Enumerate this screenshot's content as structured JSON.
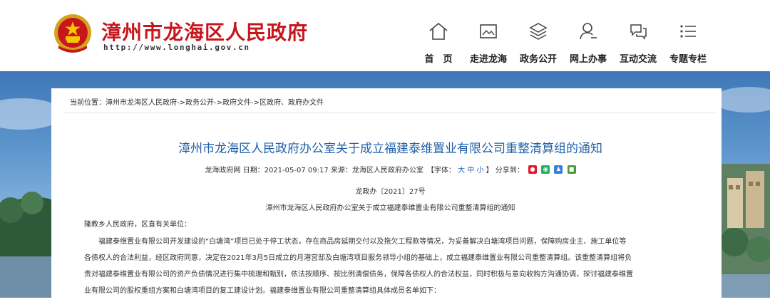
{
  "header": {
    "title": "漳州市龙海区人民政府",
    "url": "http://www.longhai.gov.cn",
    "nav": [
      {
        "label": "首　页",
        "icon": "home-icon"
      },
      {
        "label": "走进龙海",
        "icon": "picture-icon"
      },
      {
        "label": "政务公开",
        "icon": "layers-icon"
      },
      {
        "label": "网上办事",
        "icon": "user-icon"
      },
      {
        "label": "互动交流",
        "icon": "chat-icon"
      },
      {
        "label": "专题专栏",
        "icon": "list-icon"
      }
    ]
  },
  "breadcrumb": {
    "prefix": "当前位置：",
    "items": [
      "漳州市龙海区人民政府",
      "->政务公开",
      "->政府文件",
      "->区政府、政府办文件"
    ]
  },
  "article": {
    "title": "漳州市龙海区人民政府办公室关于成立福建泰维置业有限公司重整清算组的通知",
    "meta_prefix": "龙海政府网 日期：2021-05-07 09:17  来源：龙海区人民政府办公室　【字体：",
    "font_large": "大",
    "font_medium": "中",
    "font_small": "小",
    "meta_suffix": "】 分享到：",
    "doc_number": "龙政办〔2021〕27号",
    "doc_subtitle": "漳州市龙海区人民政府办公室关于成立福建泰维置业有限公司重整清算组的通知",
    "paragraphs": [
      "隆教乡人民政府，区直有关单位：",
      "　　福建泰维置业有限公司开发建设的“白塘湾”项目已处于停工状态，存在商品房延期交付以及拖欠工程款等情况，为妥善解决白塘湾项目问题，保障购房业主、施工单位等",
      "各债权人的合法利益，经区政府同意，决定在2021年3月5日成立的月港宫邸及白塘湾项目服务领导小组的基础上，成立福建泰维置业有限公司重整清算组。该重整清算组将负",
      "责对福建泰维置业有限公司的资产负债情况进行集中梳理和甄别，依法按顺序、按比例清偿债务，保障各债权人的合法权益，同时积极与意向收购方沟通协调，探讨福建泰维置",
      "业有限公司的股权重组方案和白塘湾项目的复工建设计划。福建泰维置业有限公司重整清算组具体成员名单如下："
    ]
  },
  "colors": {
    "brand_red": "#c8161d",
    "link_blue": "#1f5fa8",
    "sky_blue": "#5e96cd"
  }
}
